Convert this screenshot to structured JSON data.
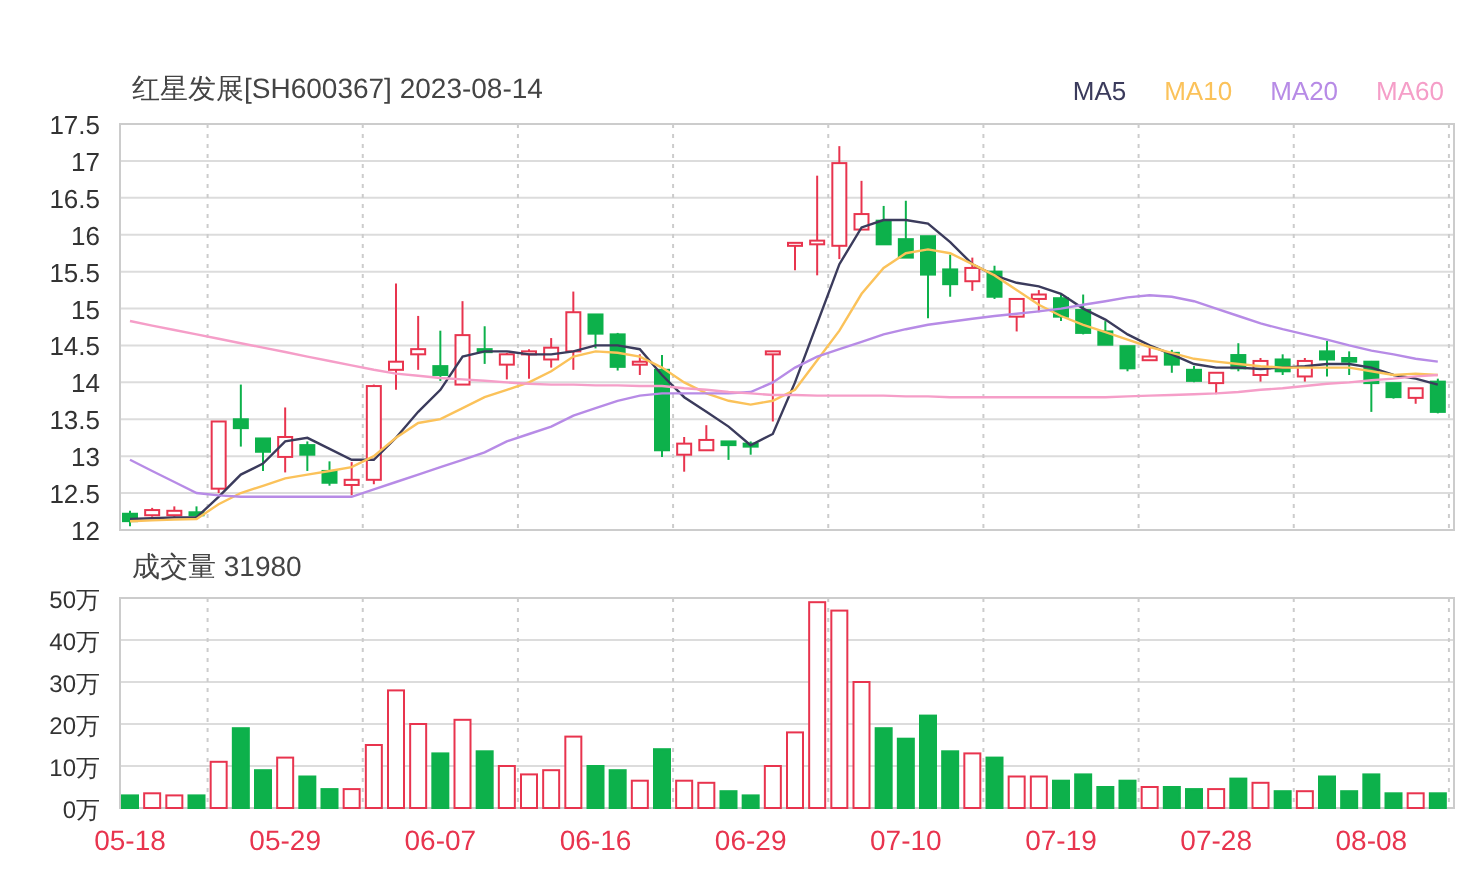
{
  "price_chart": {
    "chart_data": {
      "type": "candlestick",
      "title": "红星发展[SH600367] 2023-08-14",
      "grid": true,
      "categories": [
        null,
        null,
        null,
        null,
        null,
        null,
        null,
        null,
        null,
        null,
        null,
        null,
        null,
        null,
        null,
        null,
        null,
        null,
        null,
        null,
        null,
        null,
        null,
        null,
        null,
        null,
        null,
        null,
        null,
        null,
        null,
        null,
        null,
        null,
        null,
        null,
        null,
        null,
        null,
        null,
        null,
        null,
        null,
        null,
        null,
        null,
        null,
        null,
        null,
        null,
        null,
        null,
        null,
        null,
        null,
        null,
        null,
        null,
        null,
        null
      ],
      "ylim": [
        12,
        17.5
      ],
      "yticks": [
        12,
        12.5,
        13,
        13.5,
        14,
        14.5,
        15,
        15.5,
        16,
        16.5,
        17,
        17.5
      ],
      "ohlc": [
        [
          12.22,
          12.26,
          12.05,
          12.12
        ],
        [
          12.2,
          12.3,
          12.18,
          12.27
        ],
        [
          12.2,
          12.32,
          12.18,
          12.26
        ],
        [
          12.24,
          12.32,
          12.15,
          12.22
        ],
        [
          12.56,
          13.47,
          12.5,
          13.47
        ],
        [
          13.5,
          13.97,
          13.13,
          13.38
        ],
        [
          13.24,
          13.24,
          12.8,
          13.06
        ],
        [
          12.99,
          13.66,
          12.78,
          13.26
        ],
        [
          13.15,
          13.2,
          12.8,
          13.02
        ],
        [
          12.8,
          12.93,
          12.6,
          12.64
        ],
        [
          12.61,
          12.92,
          12.47,
          12.68
        ],
        [
          12.68,
          13.97,
          12.62,
          13.95
        ],
        [
          14.17,
          15.34,
          13.9,
          14.28
        ],
        [
          14.38,
          14.9,
          14.17,
          14.45
        ],
        [
          14.22,
          14.7,
          14.02,
          14.1
        ],
        [
          13.97,
          15.1,
          13.97,
          14.64
        ],
        [
          14.45,
          14.76,
          14.25,
          14.43
        ],
        [
          14.24,
          14.4,
          14.04,
          14.38
        ],
        [
          14.38,
          14.45,
          14.05,
          14.42
        ],
        [
          14.31,
          14.6,
          14.2,
          14.47
        ],
        [
          14.42,
          15.23,
          14.17,
          14.95
        ],
        [
          14.92,
          14.92,
          14.46,
          14.66
        ],
        [
          14.65,
          14.67,
          14.16,
          14.21
        ],
        [
          14.27,
          14.38,
          14.1,
          14.28
        ],
        [
          14.17,
          14.37,
          12.99,
          13.08
        ],
        [
          13.02,
          13.26,
          12.79,
          13.17
        ],
        [
          13.08,
          13.42,
          13.08,
          13.22
        ],
        [
          13.2,
          13.2,
          12.95,
          13.15
        ],
        [
          13.17,
          13.2,
          13.02,
          13.13
        ],
        [
          14.39,
          14.42,
          13.47,
          14.42
        ],
        [
          15.87,
          15.89,
          15.52,
          15.89
        ],
        [
          15.87,
          16.8,
          15.45,
          15.92
        ],
        [
          15.85,
          17.2,
          15.67,
          16.97
        ],
        [
          16.07,
          16.73,
          16.07,
          16.28
        ],
        [
          16.19,
          16.39,
          15.87,
          15.87
        ],
        [
          15.94,
          16.46,
          15.69,
          15.69
        ],
        [
          15.98,
          15.98,
          14.87,
          15.46
        ],
        [
          15.53,
          15.73,
          15.16,
          15.33
        ],
        [
          15.37,
          15.69,
          15.24,
          15.55
        ],
        [
          15.5,
          15.58,
          15.13,
          15.16
        ],
        [
          14.89,
          15.13,
          14.69,
          15.13
        ],
        [
          15.13,
          15.25,
          14.95,
          15.19
        ],
        [
          15.14,
          15.19,
          14.83,
          14.89
        ],
        [
          14.98,
          15.19,
          14.65,
          14.67
        ],
        [
          14.69,
          14.83,
          14.51,
          14.51
        ],
        [
          14.49,
          14.49,
          14.15,
          14.19
        ],
        [
          14.3,
          14.47,
          14.3,
          14.35
        ],
        [
          14.4,
          14.44,
          14.13,
          14.24
        ],
        [
          14.17,
          14.22,
          14.0,
          14.02
        ],
        [
          13.99,
          14.13,
          13.84,
          14.13
        ],
        [
          14.37,
          14.53,
          14.15,
          14.19
        ],
        [
          14.1,
          14.33,
          14.01,
          14.29
        ],
        [
          14.31,
          14.38,
          14.1,
          14.15
        ],
        [
          14.08,
          14.33,
          14.01,
          14.29
        ],
        [
          14.42,
          14.56,
          14.08,
          14.31
        ],
        [
          14.33,
          14.42,
          14.1,
          14.28
        ],
        [
          14.28,
          14.29,
          13.6,
          13.99
        ],
        [
          13.99,
          13.99,
          13.78,
          13.8
        ],
        [
          13.79,
          13.92,
          13.71,
          13.92
        ],
        [
          14.01,
          14.05,
          13.58,
          13.6
        ]
      ]
    },
    "moving_averages": {
      "chart_data": {
        "type": "line",
        "categories": [
          null,
          null,
          null,
          null,
          null,
          null,
          null,
          null,
          null,
          null,
          null,
          null,
          null,
          null,
          null,
          null,
          null,
          null,
          null,
          null,
          null,
          null,
          null,
          null,
          null,
          null,
          null,
          null,
          null,
          null,
          null,
          null,
          null,
          null,
          null,
          null,
          null,
          null,
          null,
          null,
          null,
          null,
          null,
          null,
          null,
          null,
          null,
          null,
          null,
          null,
          null,
          null,
          null,
          null,
          null,
          null,
          null,
          null,
          null,
          null
        ],
        "ylim": [
          12,
          17.5
        ],
        "series": [
          {
            "name": "MA5",
            "color": "#3b3b5c",
            "values": [
              12.15,
              12.16,
              12.17,
              12.17,
              12.45,
              12.75,
              12.9,
              13.2,
              13.25,
              13.1,
              12.95,
              12.95,
              13.25,
              13.6,
              13.9,
              14.35,
              14.42,
              14.42,
              14.38,
              14.38,
              14.42,
              14.5,
              14.5,
              14.45,
              14.1,
              13.8,
              13.6,
              13.4,
              13.15,
              13.3,
              14.0,
              14.8,
              15.6,
              16.1,
              16.2,
              16.2,
              16.15,
              15.9,
              15.6,
              15.45,
              15.35,
              15.3,
              15.2,
              15.0,
              14.85,
              14.65,
              14.5,
              14.38,
              14.25,
              14.2,
              14.2,
              14.18,
              14.2,
              14.22,
              14.25,
              14.25,
              14.2,
              14.1,
              14.05,
              13.97
            ]
          },
          {
            "name": "MA10",
            "color": "#fbc25a",
            "values": [
              12.12,
              12.13,
              12.14,
              12.15,
              12.35,
              12.5,
              12.6,
              12.7,
              12.75,
              12.8,
              12.85,
              13.0,
              13.25,
              13.45,
              13.5,
              13.65,
              13.8,
              13.9,
              14.0,
              14.15,
              14.35,
              14.42,
              14.4,
              14.35,
              14.2,
              14.0,
              13.85,
              13.75,
              13.7,
              13.75,
              13.9,
              14.3,
              14.7,
              15.2,
              15.55,
              15.75,
              15.8,
              15.75,
              15.6,
              15.45,
              15.25,
              15.05,
              14.9,
              14.78,
              14.68,
              14.58,
              14.48,
              14.4,
              14.32,
              14.28,
              14.25,
              14.22,
              14.2,
              14.2,
              14.2,
              14.2,
              14.15,
              14.1,
              14.12,
              14.1
            ]
          },
          {
            "name": "MA20",
            "color": "#b78be6",
            "values": [
              12.95,
              12.8,
              12.65,
              12.5,
              12.47,
              12.45,
              12.45,
              12.45,
              12.45,
              12.45,
              12.45,
              12.55,
              12.65,
              12.75,
              12.85,
              12.95,
              13.05,
              13.2,
              13.3,
              13.4,
              13.55,
              13.65,
              13.75,
              13.82,
              13.85,
              13.85,
              13.85,
              13.85,
              13.87,
              14.0,
              14.2,
              14.35,
              14.45,
              14.55,
              14.65,
              14.72,
              14.78,
              14.82,
              14.86,
              14.9,
              14.93,
              14.96,
              15.0,
              15.05,
              15.1,
              15.15,
              15.18,
              15.16,
              15.1,
              15.0,
              14.9,
              14.8,
              14.72,
              14.65,
              14.58,
              14.5,
              14.43,
              14.38,
              14.32,
              14.28
            ]
          },
          {
            "name": "MA60",
            "color": "#f59ec8",
            "values": [
              14.83,
              14.77,
              14.71,
              14.65,
              14.59,
              14.53,
              14.47,
              14.41,
              14.35,
              14.29,
              14.23,
              14.17,
              14.12,
              14.09,
              14.06,
              14.04,
              14.02,
              14.0,
              13.98,
              13.97,
              13.97,
              13.96,
              13.96,
              13.95,
              13.95,
              13.92,
              13.9,
              13.87,
              13.85,
              13.83,
              13.83,
              13.82,
              13.82,
              13.82,
              13.82,
              13.81,
              13.81,
              13.8,
              13.8,
              13.8,
              13.8,
              13.8,
              13.8,
              13.8,
              13.8,
              13.81,
              13.82,
              13.83,
              13.84,
              13.85,
              13.87,
              13.9,
              13.92,
              13.95,
              13.98,
              14.0,
              14.03,
              14.05,
              14.08,
              14.1
            ]
          }
        ]
      }
    }
  },
  "volume_chart": {
    "chart_data": {
      "type": "bar",
      "title": "成交量 31980",
      "grid": true,
      "categories": [
        "05-18",
        null,
        null,
        null,
        null,
        null,
        null,
        "05-29",
        null,
        null,
        null,
        null,
        null,
        null,
        "06-07",
        null,
        null,
        null,
        null,
        null,
        null,
        "06-16",
        null,
        null,
        null,
        null,
        null,
        null,
        "06-29",
        null,
        null,
        null,
        null,
        null,
        null,
        "07-10",
        null,
        null,
        null,
        null,
        null,
        null,
        "07-19",
        null,
        null,
        null,
        null,
        null,
        null,
        "07-28",
        null,
        null,
        null,
        null,
        null,
        null,
        "08-08",
        null,
        null,
        null
      ],
      "ylim": [
        0,
        50
      ],
      "yticks": [
        {
          "value": 0,
          "label": "0万"
        },
        {
          "value": 10,
          "label": "10万"
        },
        {
          "value": 20,
          "label": "20万"
        },
        {
          "value": 30,
          "label": "30万"
        },
        {
          "value": 40,
          "label": "40万"
        },
        {
          "value": 50,
          "label": "50万"
        }
      ],
      "series": [
        {
          "values": [
            3,
            3.5,
            3,
            3,
            11,
            19,
            9,
            12,
            7.5,
            4.5,
            4.5,
            15,
            28,
            20,
            13,
            21,
            13.5,
            10,
            8,
            9,
            17,
            10,
            9,
            6.5,
            14,
            6.5,
            6,
            4,
            3,
            10,
            18,
            49,
            47,
            30,
            19,
            16.5,
            22,
            13.5,
            13,
            12,
            7.5,
            7.5,
            6.5,
            8,
            5,
            6.5,
            5,
            5,
            4.5,
            4.5,
            7,
            6,
            4,
            4,
            7.5,
            4,
            8,
            3.5,
            3.5,
            3.5
          ]
        }
      ]
    }
  }
}
